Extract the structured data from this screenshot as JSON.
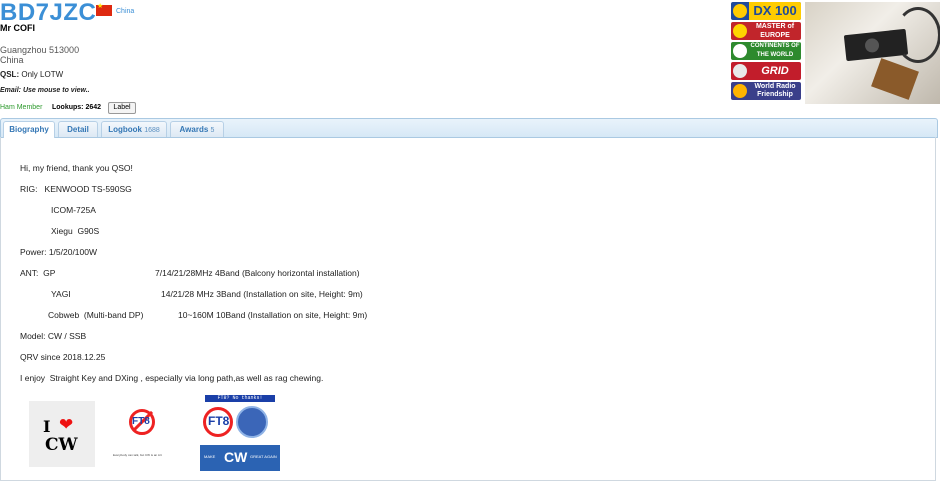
{
  "header": {
    "callsign": "BD7JZC",
    "country": "China",
    "name": "Mr COFI",
    "address_line1": "Guangzhou 513000",
    "address_line2": "China",
    "qsl_label": "QSL:",
    "qsl_value": "Only LOTW",
    "email_text": "Email: Use mouse to view..",
    "member_text": "Ham Member",
    "lookups_text": "Lookups: 2642",
    "label_button": "Label"
  },
  "badges": [
    {
      "name": "dx-100-badge",
      "text": "DX 100"
    },
    {
      "name": "master-of-europe-badge",
      "text": "MASTER of EUROPE"
    },
    {
      "name": "continents-of-the-world-badge",
      "text": "CONTINENTS OF THE WORLD"
    },
    {
      "name": "grid-badge",
      "text": "GRID"
    },
    {
      "name": "world-radio-friendship-badge",
      "text": "World Radio Friendship"
    }
  ],
  "tabs": [
    {
      "label": "Biography",
      "count": ""
    },
    {
      "label": "Detail",
      "count": ""
    },
    {
      "label": "Logbook",
      "count": "1688"
    },
    {
      "label": "Awards",
      "count": "5"
    }
  ],
  "bio": {
    "line1": "Hi, my friend, thank you QSO!",
    "rig_label": "RIG:   KENWOOD TS-590SG",
    "rig2": "ICOM-725A",
    "rig3": "Xiegu  G90S",
    "power": "Power: 1/5/20/100W",
    "ant_label": "ANT:  GP",
    "ant_gp": "7/14/21/28MHz 4Band (Balcony horizontal installation)",
    "yagi_label": "YAGI",
    "ant_yagi": "14/21/28 MHz 3Band (Installation on site, Height: 9m)",
    "cobweb_label": "Cobweb  (Multi-band DP)",
    "ant_cobweb": "10~160M 10Band (Installation on site, Height: 9m)",
    "model": "Model: CW / SSB",
    "qrv": "QRV since 2018.12.25",
    "enjoy": "I enjoy  Straight Key and DXing , especially via long path,as well as rag chewing."
  },
  "logos": {
    "i_love_cw_i": "I",
    "i_love_cw_cw": "CW",
    "ft8_text": "FT8",
    "ft8_small": "Everybody can talk, but CW is an Art",
    "make_top": "FT8? No thanks!",
    "make_make": "MAKE",
    "make_cw": "CW",
    "make_great": "GREAT AGAIN"
  },
  "colors": {
    "callsign": "#3b8fd6",
    "tab_text": "#3477b5",
    "member": "#2e9a2e"
  }
}
